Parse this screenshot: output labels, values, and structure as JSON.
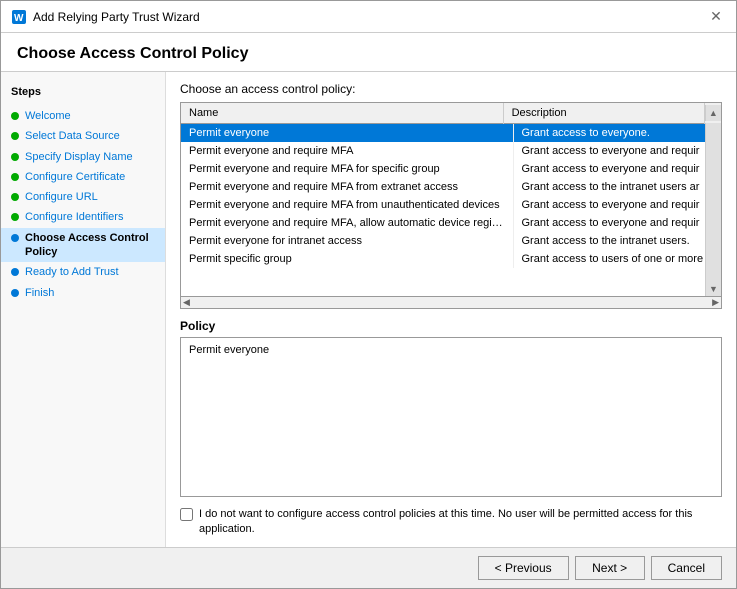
{
  "window": {
    "title": "Add Relying Party Trust Wizard",
    "close_label": "✕"
  },
  "page_title": "Choose Access Control Policy",
  "sidebar": {
    "title": "Steps",
    "items": [
      {
        "id": "welcome",
        "label": "Welcome",
        "dot": "green"
      },
      {
        "id": "select-data-source",
        "label": "Select Data Source",
        "dot": "green"
      },
      {
        "id": "specify-display-name",
        "label": "Specify Display Name",
        "dot": "green"
      },
      {
        "id": "configure-certificate",
        "label": "Configure Certificate",
        "dot": "green"
      },
      {
        "id": "configure-url",
        "label": "Configure URL",
        "dot": "green"
      },
      {
        "id": "configure-identifiers",
        "label": "Configure Identifiers",
        "dot": "green"
      },
      {
        "id": "choose-access-control-policy",
        "label": "Choose Access Control Policy",
        "dot": "blue",
        "active": true
      },
      {
        "id": "ready-to-add-trust",
        "label": "Ready to Add Trust",
        "dot": "blue"
      },
      {
        "id": "finish",
        "label": "Finish",
        "dot": "blue"
      }
    ]
  },
  "main": {
    "section_label": "Choose an access control policy:",
    "table": {
      "col_name": "Name",
      "col_desc": "Description",
      "rows": [
        {
          "name": "Permit everyone",
          "desc": "Grant access to everyone.",
          "selected": true
        },
        {
          "name": "Permit everyone and require MFA",
          "desc": "Grant access to everyone and requir"
        },
        {
          "name": "Permit everyone and require MFA for specific group",
          "desc": "Grant access to everyone and requir"
        },
        {
          "name": "Permit everyone and require MFA from extranet access",
          "desc": "Grant access to the intranet users ar"
        },
        {
          "name": "Permit everyone and require MFA from unauthenticated devices",
          "desc": "Grant access to everyone and requir"
        },
        {
          "name": "Permit everyone and require MFA, allow automatic device registr...",
          "desc": "Grant access to everyone and requir"
        },
        {
          "name": "Permit everyone for intranet access",
          "desc": "Grant access to the intranet users."
        },
        {
          "name": "Permit specific group",
          "desc": "Grant access to users of one or more"
        }
      ]
    },
    "policy_label": "Policy",
    "policy_text": "Permit everyone",
    "checkbox_label": "I do not want to configure access control policies at this time. No user will be permitted access for this application."
  },
  "footer": {
    "prev_label": "< Previous",
    "next_label": "Next >",
    "cancel_label": "Cancel"
  }
}
